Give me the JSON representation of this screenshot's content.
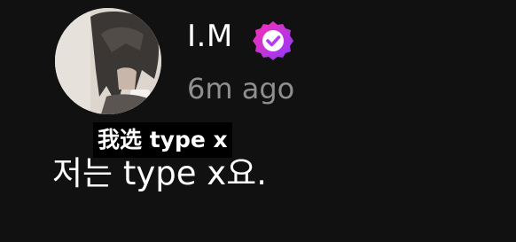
{
  "post": {
    "username": "I.M",
    "timestamp": "6m ago",
    "caption": "我选 type x",
    "message": "저는 type x요."
  },
  "badge": {
    "icon": "verified-badge-icon",
    "color_start": "#ff2db0",
    "color_end": "#8a3bff"
  },
  "avatar": {
    "icon": "profile-photo"
  }
}
